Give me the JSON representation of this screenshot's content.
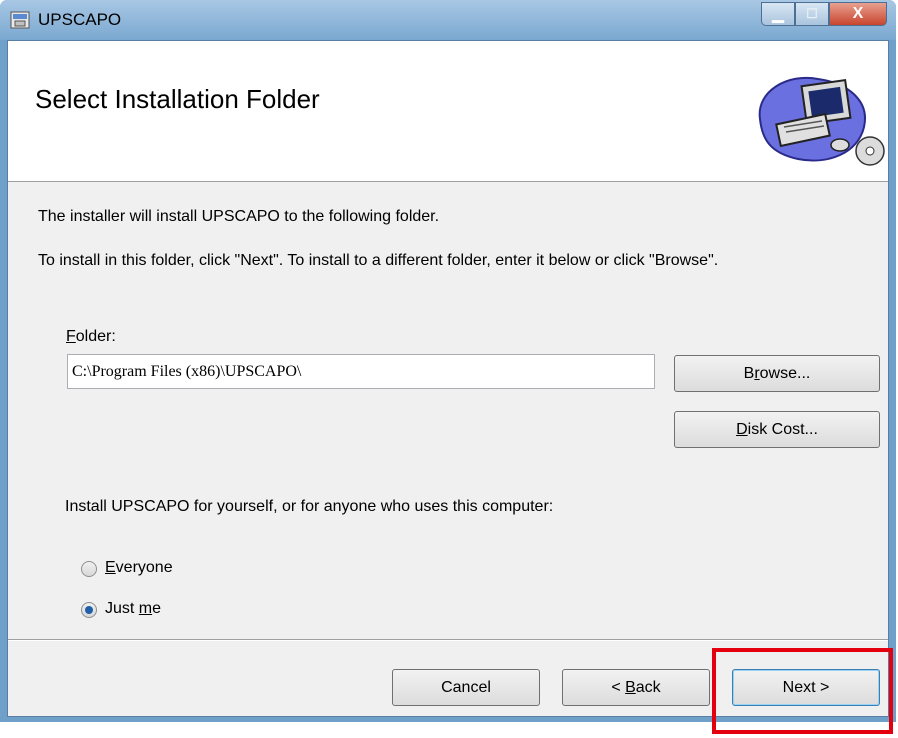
{
  "window": {
    "title": "UPSCAPO",
    "controls": {
      "minimize": "▁",
      "maximize": "☐",
      "close": "X"
    }
  },
  "header": {
    "title": "Select Installation Folder",
    "graphic_icon": "computer-cd-icon"
  },
  "body": {
    "intro": "The installer will install UPSCAPO to the following folder.",
    "instructions": "To install in this folder, click \"Next\". To install to a different folder, enter it below or click \"Browse\".",
    "folder_label_key": "F",
    "folder_label_rest": "older:",
    "folder_value": "C:\\Program Files (x86)\\UPSCAPO\\",
    "browse_pre": "B",
    "browse_key": "r",
    "browse_post": "owse...",
    "diskcost_key": "D",
    "diskcost_rest": "isk Cost...",
    "install_for": "Install UPSCAPO for yourself, or for anyone who uses this computer:",
    "radio_everyone_key": "E",
    "radio_everyone_rest": "veryone",
    "radio_justme_pre": "Just ",
    "radio_justme_key": "m",
    "radio_justme_post": "e",
    "selected_option": "Just me"
  },
  "footer": {
    "cancel": "Cancel",
    "back_pre": "< ",
    "back_key": "B",
    "back_post": "ack",
    "next": "Next >"
  },
  "colors": {
    "highlight": "#e3000f",
    "titlebar": "#7aa8d0"
  }
}
